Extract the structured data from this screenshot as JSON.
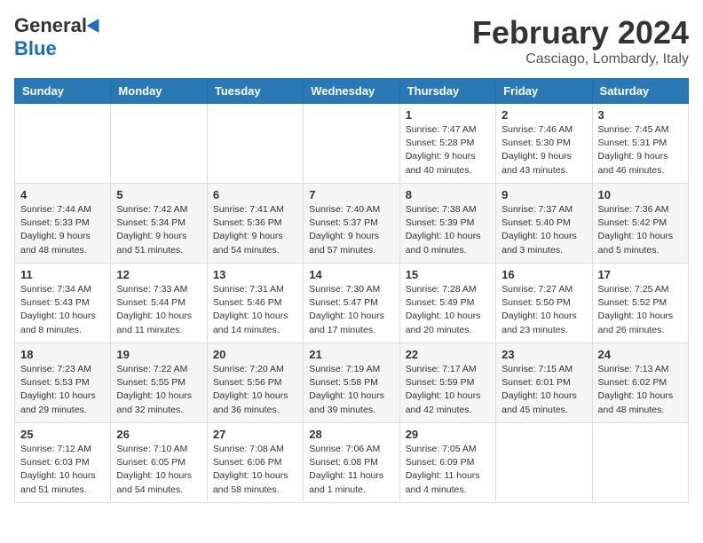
{
  "logo": {
    "general": "General",
    "blue": "Blue"
  },
  "title": {
    "month_year": "February 2024",
    "location": "Casciago, Lombardy, Italy"
  },
  "headers": [
    "Sunday",
    "Monday",
    "Tuesday",
    "Wednesday",
    "Thursday",
    "Friday",
    "Saturday"
  ],
  "weeks": [
    [
      {
        "day": "",
        "info": ""
      },
      {
        "day": "",
        "info": ""
      },
      {
        "day": "",
        "info": ""
      },
      {
        "day": "",
        "info": ""
      },
      {
        "day": "1",
        "info": "Sunrise: 7:47 AM\nSunset: 5:28 PM\nDaylight: 9 hours\nand 40 minutes."
      },
      {
        "day": "2",
        "info": "Sunrise: 7:46 AM\nSunset: 5:30 PM\nDaylight: 9 hours\nand 43 minutes."
      },
      {
        "day": "3",
        "info": "Sunrise: 7:45 AM\nSunset: 5:31 PM\nDaylight: 9 hours\nand 46 minutes."
      }
    ],
    [
      {
        "day": "4",
        "info": "Sunrise: 7:44 AM\nSunset: 5:33 PM\nDaylight: 9 hours\nand 48 minutes."
      },
      {
        "day": "5",
        "info": "Sunrise: 7:42 AM\nSunset: 5:34 PM\nDaylight: 9 hours\nand 51 minutes."
      },
      {
        "day": "6",
        "info": "Sunrise: 7:41 AM\nSunset: 5:36 PM\nDaylight: 9 hours\nand 54 minutes."
      },
      {
        "day": "7",
        "info": "Sunrise: 7:40 AM\nSunset: 5:37 PM\nDaylight: 9 hours\nand 57 minutes."
      },
      {
        "day": "8",
        "info": "Sunrise: 7:38 AM\nSunset: 5:39 PM\nDaylight: 10 hours\nand 0 minutes."
      },
      {
        "day": "9",
        "info": "Sunrise: 7:37 AM\nSunset: 5:40 PM\nDaylight: 10 hours\nand 3 minutes."
      },
      {
        "day": "10",
        "info": "Sunrise: 7:36 AM\nSunset: 5:42 PM\nDaylight: 10 hours\nand 5 minutes."
      }
    ],
    [
      {
        "day": "11",
        "info": "Sunrise: 7:34 AM\nSunset: 5:43 PM\nDaylight: 10 hours\nand 8 minutes."
      },
      {
        "day": "12",
        "info": "Sunrise: 7:33 AM\nSunset: 5:44 PM\nDaylight: 10 hours\nand 11 minutes."
      },
      {
        "day": "13",
        "info": "Sunrise: 7:31 AM\nSunset: 5:46 PM\nDaylight: 10 hours\nand 14 minutes."
      },
      {
        "day": "14",
        "info": "Sunrise: 7:30 AM\nSunset: 5:47 PM\nDaylight: 10 hours\nand 17 minutes."
      },
      {
        "day": "15",
        "info": "Sunrise: 7:28 AM\nSunset: 5:49 PM\nDaylight: 10 hours\nand 20 minutes."
      },
      {
        "day": "16",
        "info": "Sunrise: 7:27 AM\nSunset: 5:50 PM\nDaylight: 10 hours\nand 23 minutes."
      },
      {
        "day": "17",
        "info": "Sunrise: 7:25 AM\nSunset: 5:52 PM\nDaylight: 10 hours\nand 26 minutes."
      }
    ],
    [
      {
        "day": "18",
        "info": "Sunrise: 7:23 AM\nSunset: 5:53 PM\nDaylight: 10 hours\nand 29 minutes."
      },
      {
        "day": "19",
        "info": "Sunrise: 7:22 AM\nSunset: 5:55 PM\nDaylight: 10 hours\nand 32 minutes."
      },
      {
        "day": "20",
        "info": "Sunrise: 7:20 AM\nSunset: 5:56 PM\nDaylight: 10 hours\nand 36 minutes."
      },
      {
        "day": "21",
        "info": "Sunrise: 7:19 AM\nSunset: 5:58 PM\nDaylight: 10 hours\nand 39 minutes."
      },
      {
        "day": "22",
        "info": "Sunrise: 7:17 AM\nSunset: 5:59 PM\nDaylight: 10 hours\nand 42 minutes."
      },
      {
        "day": "23",
        "info": "Sunrise: 7:15 AM\nSunset: 6:01 PM\nDaylight: 10 hours\nand 45 minutes."
      },
      {
        "day": "24",
        "info": "Sunrise: 7:13 AM\nSunset: 6:02 PM\nDaylight: 10 hours\nand 48 minutes."
      }
    ],
    [
      {
        "day": "25",
        "info": "Sunrise: 7:12 AM\nSunset: 6:03 PM\nDaylight: 10 hours\nand 51 minutes."
      },
      {
        "day": "26",
        "info": "Sunrise: 7:10 AM\nSunset: 6:05 PM\nDaylight: 10 hours\nand 54 minutes."
      },
      {
        "day": "27",
        "info": "Sunrise: 7:08 AM\nSunset: 6:06 PM\nDaylight: 10 hours\nand 58 minutes."
      },
      {
        "day": "28",
        "info": "Sunrise: 7:06 AM\nSunset: 6:08 PM\nDaylight: 11 hours\nand 1 minute."
      },
      {
        "day": "29",
        "info": "Sunrise: 7:05 AM\nSunset: 6:09 PM\nDaylight: 11 hours\nand 4 minutes."
      },
      {
        "day": "",
        "info": ""
      },
      {
        "day": "",
        "info": ""
      }
    ]
  ]
}
